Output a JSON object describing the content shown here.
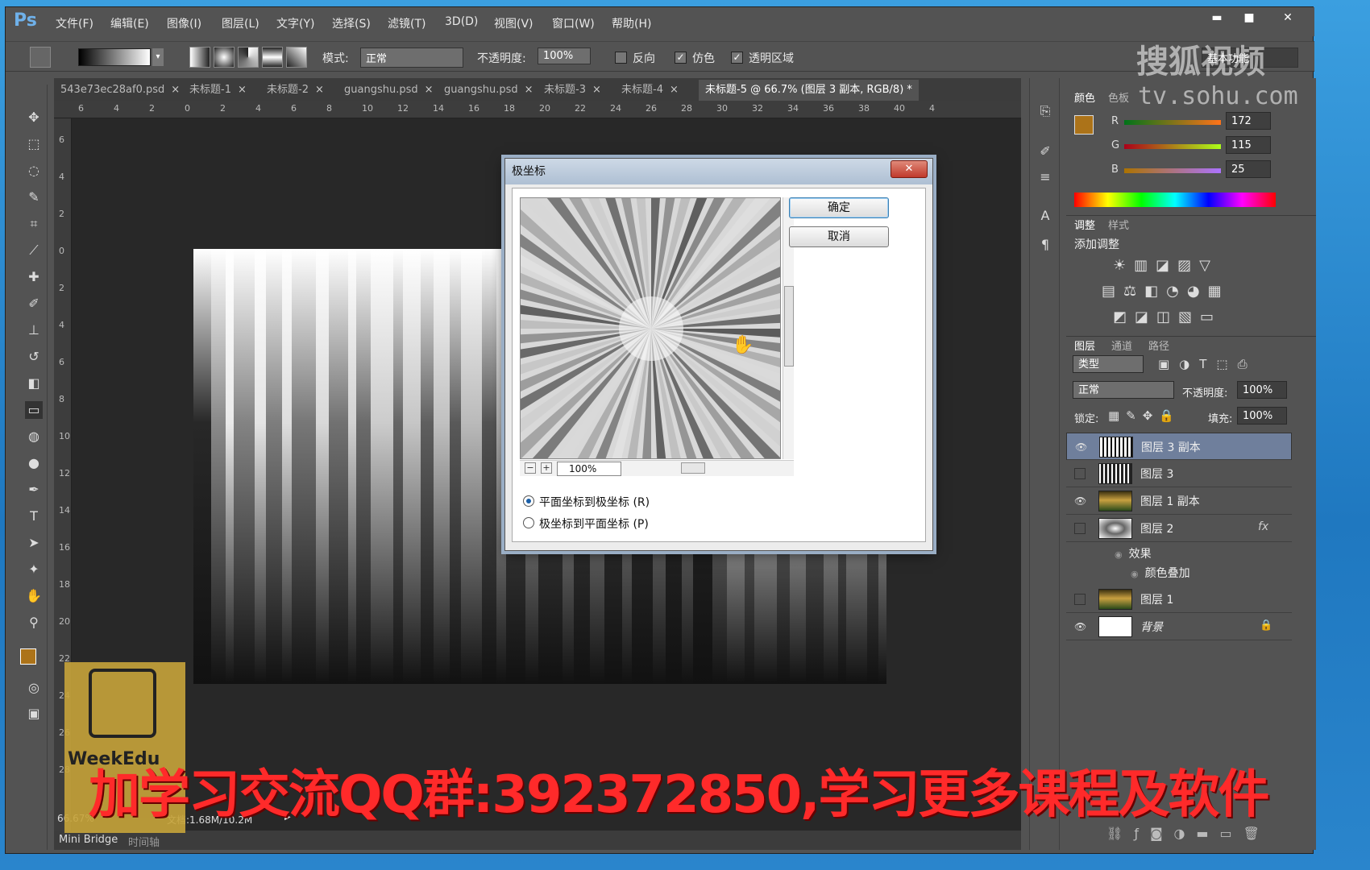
{
  "app": {
    "logo": "Ps",
    "menus": [
      "文件(F)",
      "编辑(E)",
      "图像(I)",
      "图层(L)",
      "文字(Y)",
      "选择(S)",
      "滤镜(T)",
      "3D(D)",
      "视图(V)",
      "窗口(W)",
      "帮助(H)"
    ],
    "win_min": "▬",
    "win_max": "■",
    "win_close": "✕"
  },
  "options": {
    "mode_label": "模式:",
    "mode_value": "正常",
    "opacity_label": "不透明度:",
    "opacity_value": "100%",
    "reverse_label": "反向",
    "dither_label": "仿色",
    "transparency_label": "透明区域",
    "dither_checked": "✓",
    "transparency_checked": "✓",
    "workspace": "基本功能"
  },
  "tabs": [
    "543e73ec28af0.psd",
    "未标题-1",
    "未标题-2",
    "guangshu.psd",
    "guangshu.psd",
    "未标题-3",
    "未标题-4",
    "未标题-5 @ 66.7% (图层 3 副本, RGB/8) *"
  ],
  "ruler_h": [
    "6",
    "4",
    "2",
    "0",
    "2",
    "4",
    "6",
    "8",
    "10",
    "12",
    "14",
    "16",
    "18",
    "20",
    "22",
    "24",
    "26",
    "28",
    "30",
    "32",
    "34",
    "36",
    "38",
    "40",
    "4"
  ],
  "ruler_v": [
    "6",
    "4",
    "2",
    "0",
    "2",
    "4",
    "6",
    "8",
    "10",
    "12",
    "14",
    "16",
    "18",
    "20",
    "22",
    "24",
    "26",
    "28"
  ],
  "status": {
    "zoom": "66.67%",
    "doc": "文档:1.68M/10.2M"
  },
  "bottom_tabs": [
    "Mini Bridge",
    "时间轴"
  ],
  "color_panel": {
    "tabs": [
      "颜色",
      "色板"
    ],
    "r_label": "R",
    "g_label": "G",
    "b_label": "B",
    "r": "172",
    "g": "115",
    "b": "25",
    "fg": "#ac7319"
  },
  "adjust_panel": {
    "tabs": [
      "调整",
      "样式"
    ],
    "title": "添加调整"
  },
  "layers_panel": {
    "tabs": [
      "图层",
      "通道",
      "路径"
    ],
    "filter_label": "类型",
    "blend": "正常",
    "opacity_label": "不透明度:",
    "opacity": "100%",
    "lock_label": "锁定:",
    "fill_label": "填充:",
    "fill": "100%",
    "layers": [
      {
        "name": "图层 3 副本"
      },
      {
        "name": "图层 3"
      },
      {
        "name": "图层 1 副本"
      },
      {
        "name": "图层 2",
        "fx": "fx"
      },
      {
        "name": "效果"
      },
      {
        "name": "颜色叠加"
      },
      {
        "name": "图层 1"
      },
      {
        "name": "背景"
      }
    ]
  },
  "dialog": {
    "title": "极坐标",
    "close": "✕",
    "ok": "确定",
    "cancel": "取消",
    "zoom": "100%",
    "option1": "平面坐标到极坐标 (R)",
    "option2": "极坐标到平面坐标 (P)"
  },
  "watermark": {
    "line1": "搜狐视频",
    "line2": "tv.sohu.com"
  },
  "promo": "加学习交流QQ群:392372850,学习更多课程及软件",
  "logo_text": "WeekEdu"
}
